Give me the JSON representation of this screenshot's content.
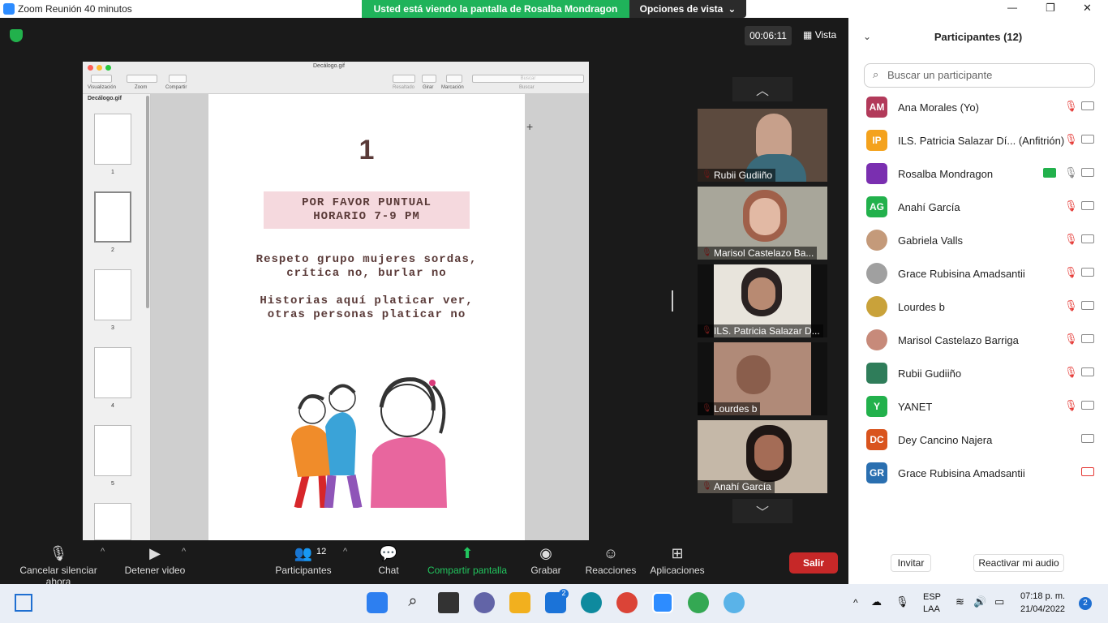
{
  "titlebar": {
    "title": "Zoom Reunión 40 minutos",
    "minimize_icon": "—",
    "restore_icon": "❐",
    "close_icon": "✕"
  },
  "share_banner": {
    "text": "Usted está viendo la pantalla de Rosalba Mondragon",
    "view_options": "Opciones de vista",
    "view_options_caret": "⌄"
  },
  "meeting": {
    "timer": "00:06:11",
    "view_label": "Vista"
  },
  "shared_window": {
    "filename": "Decálogo.gif",
    "toolbar_labels": {
      "view": "Visualización",
      "zoom": "Zoom",
      "share": "Compartir",
      "highlight": "Resaltado",
      "rotate": "Girar",
      "markup": "Marcación",
      "search": "Buscar",
      "search_placeholder": "Buscar"
    },
    "sidebar_title": "Decálogo.gif",
    "thumbnails": [
      "1",
      "2",
      "3",
      "4",
      "5"
    ],
    "page": {
      "number": "1",
      "pink_box_line1": "POR FAVOR PUNTUAL",
      "pink_box_line2": "HORARIO 7-9 PM",
      "text1_line1": "Respeto grupo mujeres sordas,",
      "text1_line2": "crítica no, burlar no",
      "text2_line1": "Historias aquí platicar ver,",
      "text2_line2": "otras personas platicar no"
    }
  },
  "video_tiles": [
    {
      "name": "Rubii Gudiiño",
      "muted": true
    },
    {
      "name": "Marisol Castelazo Ba...",
      "muted": true
    },
    {
      "name": "ILS. Patricia Salazar D...",
      "muted": true
    },
    {
      "name": "Lourdes b",
      "muted": true
    },
    {
      "name": "Anahí García",
      "muted": true
    }
  ],
  "participants_panel": {
    "title": "Participantes (12)",
    "search_placeholder": "Buscar un participante",
    "participants": [
      {
        "initials": "AM",
        "color": "#b23a5a",
        "name": "Ana Morales (Yo)",
        "mic": "muted",
        "cam": "on"
      },
      {
        "initials": "IP",
        "color": "#f4a21d",
        "name": "ILS. Patricia Salazar Dí...  (Anfitrión)",
        "mic": "muted",
        "cam": "on"
      },
      {
        "initials": "",
        "color": "#7a2fb0",
        "name": "Rosalba Mondragon",
        "mic": "on",
        "cam": "on",
        "sharing": true
      },
      {
        "initials": "AG",
        "color": "#22b14c",
        "name": "Anahí García",
        "mic": "muted",
        "cam": "on"
      },
      {
        "initials": "",
        "color": "#c49a7a",
        "name": "Gabriela Valls",
        "mic": "muted",
        "cam": "on"
      },
      {
        "initials": "",
        "color": "#a0a0a0",
        "name": "Grace Rubisina Amadsantii",
        "mic": "muted",
        "cam": "on"
      },
      {
        "initials": "",
        "color": "#c9a23a",
        "name": "Lourdes b",
        "mic": "muted",
        "cam": "on"
      },
      {
        "initials": "",
        "color": "#c78a7a",
        "name": "Marisol Castelazo Barriga",
        "mic": "muted",
        "cam": "on"
      },
      {
        "initials": "",
        "color": "#2f7d5a",
        "name": "Rubii Gudiiño",
        "mic": "muted",
        "cam": "on"
      },
      {
        "initials": "Y",
        "color": "#22b14c",
        "name": "YANET",
        "mic": "muted",
        "cam": "on"
      },
      {
        "initials": "DC",
        "color": "#d9541e",
        "name": "Dey Cancino Najera",
        "mic": "none",
        "cam": "on"
      },
      {
        "initials": "GR",
        "color": "#2a6fb0",
        "name": "Grace Rubisina Amadsantii",
        "mic": "none",
        "cam": "off"
      }
    ],
    "invite": "Invitar",
    "unmute_all": "Reactivar mi audio"
  },
  "toolbar": {
    "unmute": "Cancelar silenciar ahora",
    "stop_video": "Detener video",
    "participants": "Participantes",
    "participants_count": "12",
    "chat": "Chat",
    "share_screen": "Compartir pantalla",
    "record": "Grabar",
    "reactions": "Reacciones",
    "apps": "Aplicaciones",
    "leave": "Salir"
  },
  "taskbar": {
    "lang1": "ESP",
    "lang2": "LAA",
    "time": "07:18 p. m.",
    "date": "21/04/2022",
    "notifications": "2",
    "mail_badge": "2"
  }
}
